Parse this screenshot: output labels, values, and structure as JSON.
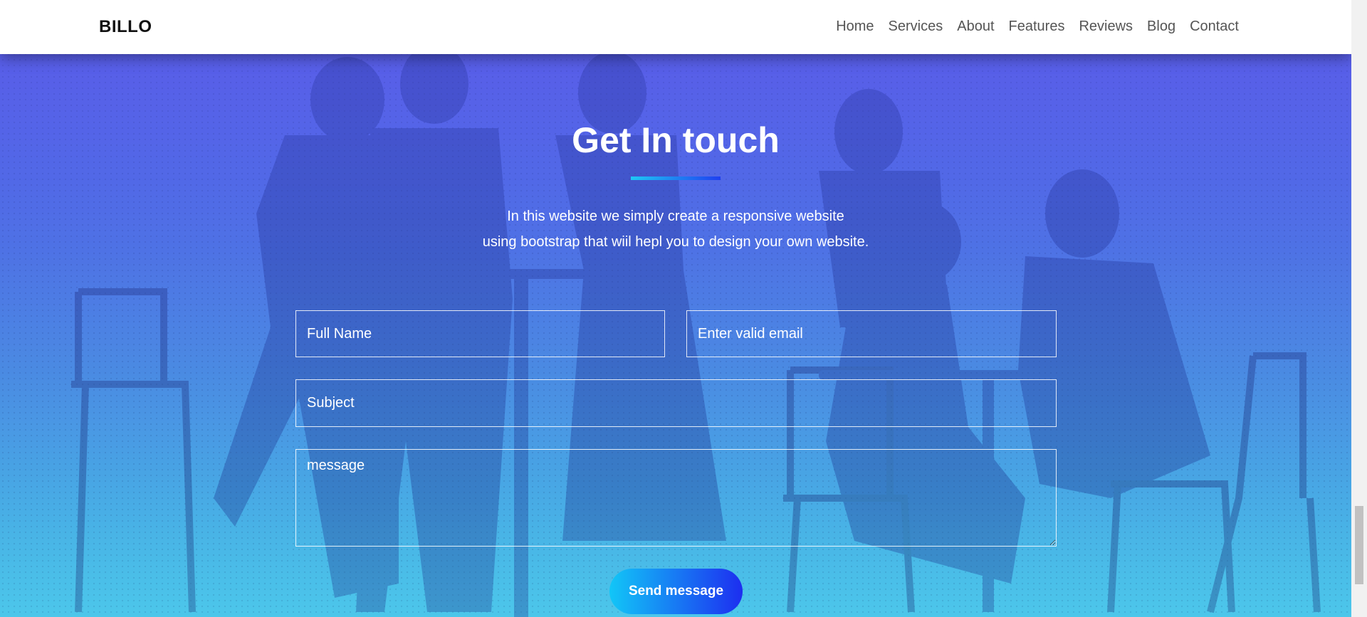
{
  "navbar": {
    "brand": "BILLO",
    "links": [
      "Home",
      "Services",
      "About",
      "Features",
      "Reviews",
      "Blog",
      "Contact"
    ]
  },
  "contact": {
    "title": "Get In touch",
    "subtitle_line1": "In this website we simply create a responsive website",
    "subtitle_line2": "using bootstrap that wiil hepl you to design your own website.",
    "name_placeholder": "Full Name",
    "email_placeholder": "Enter valid email",
    "subject_placeholder": "Subject",
    "message_placeholder": "message",
    "send_label": "Send message"
  },
  "colors": {
    "gradient_top": "#5a5ae8",
    "gradient_bottom": "#4cc6ea",
    "button_start": "#12c6f7",
    "button_end": "#1d2ef0",
    "brand_text": "#111111",
    "nav_text": "#555555"
  }
}
